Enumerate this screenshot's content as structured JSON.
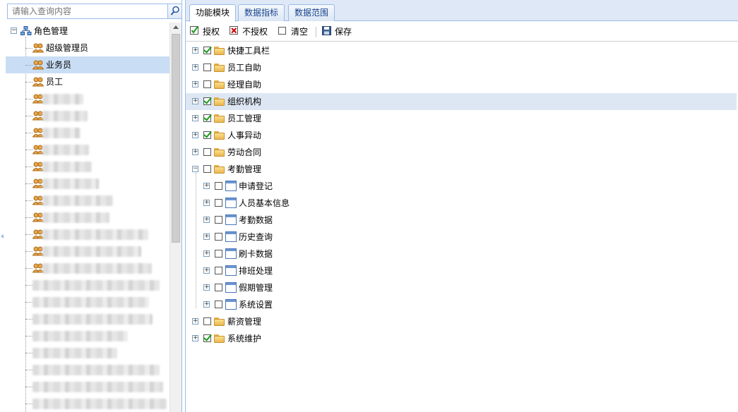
{
  "search": {
    "placeholder": "请输入查询内容"
  },
  "left_tree": {
    "root_label": "角色管理",
    "roles": [
      {
        "label": "超级管理员",
        "selected": false
      },
      {
        "label": "业务员",
        "selected": true
      },
      {
        "label": "员工",
        "selected": false
      }
    ],
    "obscured_count": 19
  },
  "tabs": [
    {
      "label": "功能模块",
      "active": true
    },
    {
      "label": "数据指标",
      "active": false
    },
    {
      "label": "数据范围",
      "active": false
    }
  ],
  "toolbar": {
    "grant_label": "授权",
    "revoke_label": "不授权",
    "clear_label": "清空",
    "save_label": "保存"
  },
  "modules": [
    {
      "label": "快捷工具栏",
      "checked": true,
      "expanded": false,
      "level": 0
    },
    {
      "label": "员工自助",
      "checked": false,
      "expanded": false,
      "level": 0
    },
    {
      "label": "经理自助",
      "checked": false,
      "expanded": false,
      "level": 0
    },
    {
      "label": "组织机构",
      "checked": true,
      "expanded": false,
      "level": 0,
      "highlighted": true
    },
    {
      "label": "员工管理",
      "checked": true,
      "expanded": false,
      "level": 0
    },
    {
      "label": "人事异动",
      "checked": true,
      "expanded": false,
      "level": 0
    },
    {
      "label": "劳动合同",
      "checked": false,
      "expanded": false,
      "level": 0
    },
    {
      "label": "考勤管理",
      "checked": false,
      "expanded": true,
      "level": 0
    },
    {
      "label": "申请登记",
      "checked": false,
      "expanded": false,
      "level": 1
    },
    {
      "label": "人员基本信息",
      "checked": false,
      "expanded": false,
      "level": 1
    },
    {
      "label": "考勤数据",
      "checked": false,
      "expanded": false,
      "level": 1
    },
    {
      "label": "历史查询",
      "checked": false,
      "expanded": false,
      "level": 1
    },
    {
      "label": "刷卡数据",
      "checked": false,
      "expanded": false,
      "level": 1
    },
    {
      "label": "排班处理",
      "checked": false,
      "expanded": false,
      "level": 1
    },
    {
      "label": "假期管理",
      "checked": false,
      "expanded": false,
      "level": 1
    },
    {
      "label": "系统设置",
      "checked": false,
      "expanded": false,
      "level": 1
    },
    {
      "label": "薪资管理",
      "checked": false,
      "expanded": false,
      "level": 0
    },
    {
      "label": "系统维护",
      "checked": true,
      "expanded": false,
      "level": 0
    }
  ],
  "colors": {
    "border": "#99bbe8",
    "selected_row": "#c9def5",
    "highlight_row": "#dde7f3",
    "check_green": "#1d9a1d",
    "revoke_red": "#d00000",
    "tab_text": "#15428b"
  },
  "icons": {
    "search": "search-icon",
    "root": "org-tree-icon",
    "role": "user-group-icon",
    "module": "folder-icon",
    "page": "window-icon",
    "save": "floppy-disk-icon"
  }
}
